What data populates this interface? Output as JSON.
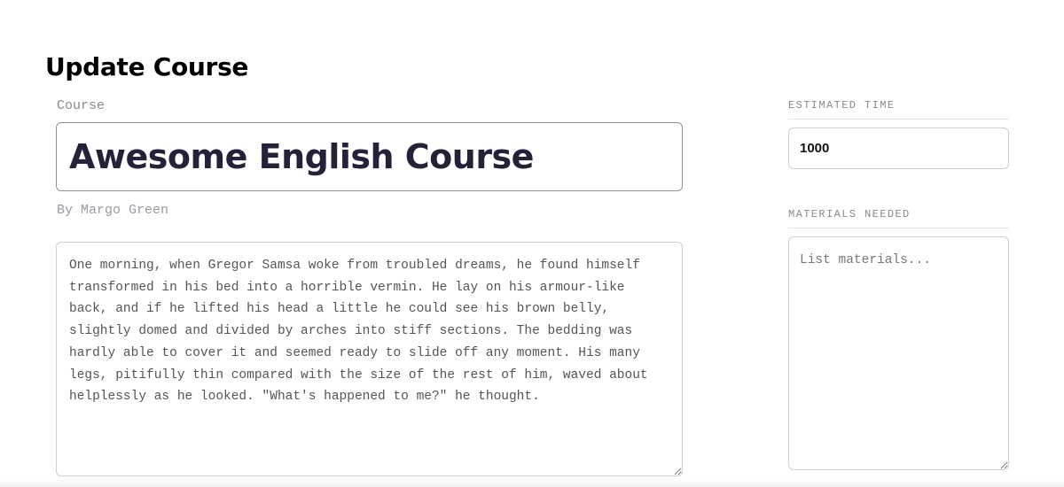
{
  "page": {
    "title": "Update Course"
  },
  "course": {
    "label": "Course",
    "title_value": "Awesome English Course",
    "author_line": "By Margo Green",
    "description": "One morning, when Gregor Samsa woke from troubled dreams, he found himself transformed in his bed into a horrible vermin. He lay on his armour-like back, and if he lifted his head a little he could see his brown belly, slightly domed and divided by arches into stiff sections. The bedding was hardly able to cover it and seemed ready to slide off any moment. His many legs, pitifully thin compared with the size of the rest of him, waved about helplessly as he looked. \"What's happened to me?\" he thought."
  },
  "sidebar": {
    "estimated_time": {
      "label": "ESTIMATED TIME",
      "value": "1000"
    },
    "materials": {
      "label": "MATERIALS NEEDED",
      "placeholder": "List materials...",
      "value": ""
    }
  }
}
